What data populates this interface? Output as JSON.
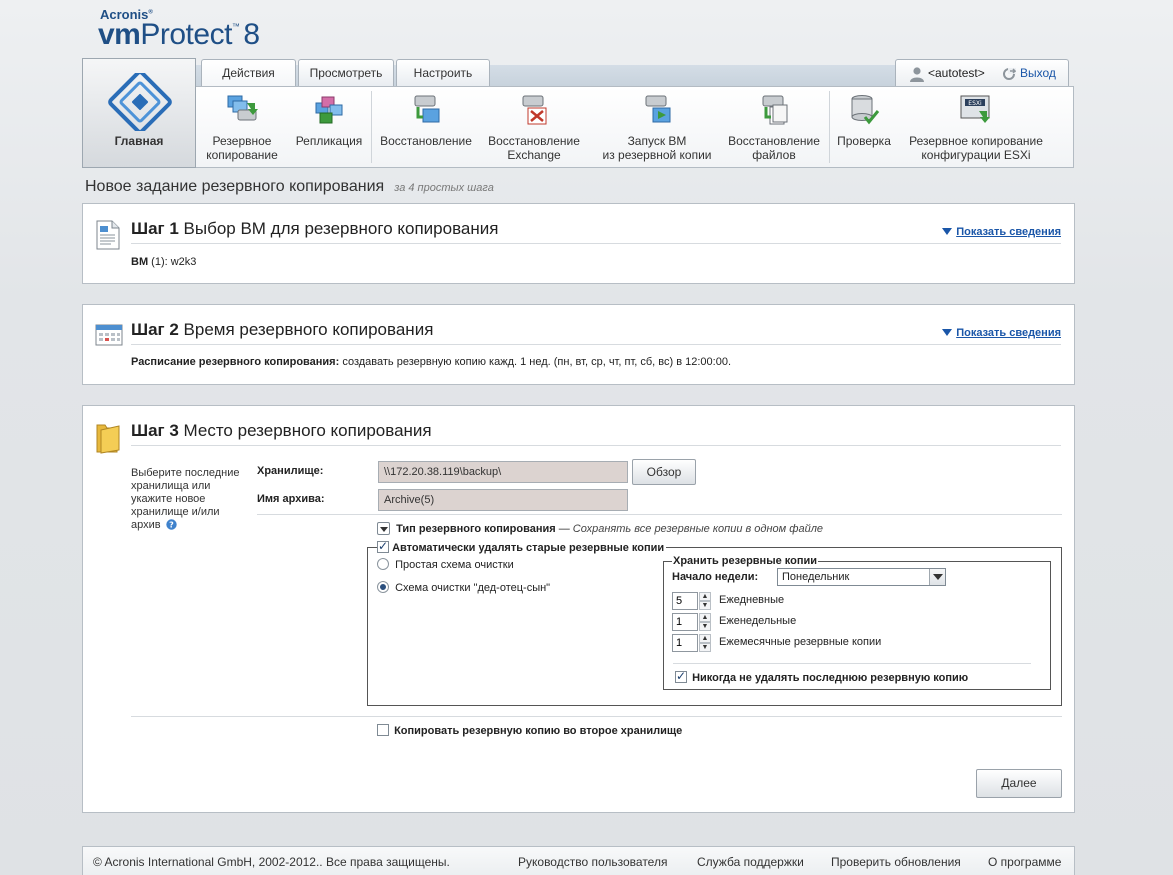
{
  "logo": {
    "brand": "Acronis",
    "product_prefix": "vm",
    "product": "Protect",
    "version": "8"
  },
  "tabs": [
    {
      "label": "Действия"
    },
    {
      "label": "Просмотреть"
    },
    {
      "label": "Настроить"
    }
  ],
  "home": {
    "label": "Главная"
  },
  "toolbar": {
    "backup": "Резервное\nкопирование",
    "replication": "Репликация",
    "recovery": "Восстановление",
    "recovery_exchange": "Восстановление\nExchange",
    "run_vm": "Запуск ВМ\nиз резервной копии",
    "recovery_files": "Восстановление\nфайлов",
    "check": "Проверка",
    "backup_esxi": "Резервное копирование\nконфигурации ESXi",
    "esxi_badge": "ESXi"
  },
  "user": {
    "name": "<autotest>",
    "logout": "Выход"
  },
  "page": {
    "title": "Новое задание резервного копирования",
    "subtitle": "за 4 простых шага"
  },
  "step1": {
    "num": "Шаг 1",
    "title": "Выбор ВМ для резервного копирования",
    "show": "Показать сведения",
    "vm_label": "ВМ",
    "vm_value": " (1): w2k3"
  },
  "step2": {
    "num": "Шаг 2",
    "title": "Время резервного копирования",
    "show": "Показать сведения",
    "schedule_label": "Расписание резервного копирования:",
    "schedule_value": " создавать резервную копию кажд. 1 нед. (пн, вт, ср, чт, пт, сб, вс) в 12:00:00."
  },
  "step3": {
    "num": "Шаг 3",
    "title": "Место резервного копирования",
    "hint": "Выберите последние хранилища или укажите новое хранилище и/или архив",
    "storage_label": "Хранилище:",
    "storage_value": "\\\\172.20.38.119\\backup\\",
    "browse": "Обзор",
    "archive_label": "Имя архива:",
    "archive_value": "Archive(5)",
    "backup_type_label": "Тип резервного копирования",
    "backup_type_dash": " — ",
    "backup_type_value": "Сохранять все резервные копии в одном файле",
    "auto_delete": "Автоматически удалять старые резервные копии",
    "simple_scheme": "Простая схема очистки",
    "gfs_scheme": "Схема очистки \"дед-отец-сын\"",
    "keep_title": "Хранить резервные копии",
    "week_start_label": "Начало недели:",
    "week_start_value": "Понедельник",
    "daily_value": "5",
    "daily_label": "Ежедневные",
    "weekly_value": "1",
    "weekly_label": "Еженедельные",
    "monthly_value": "1",
    "monthly_label": "Ежемесячные резервные копии",
    "never_delete_last": "Никогда не удалять последнюю резервную копию",
    "copy_second": "Копировать резервную копию во второе хранилище",
    "next": "Далее"
  },
  "footer": {
    "copyright": "© Acronis International GmbH, 2002-2012.. Все права защищены.",
    "guide": "Руководство пользователя",
    "support": "Служба поддержки",
    "updates": "Проверить обновления",
    "about": "О программе"
  },
  "colors": {
    "link": "#1a56a8",
    "brand": "#1f4f86"
  }
}
